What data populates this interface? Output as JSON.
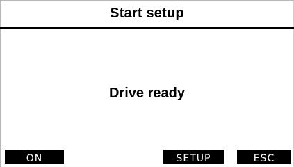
{
  "header": {
    "title": "Start setup"
  },
  "main": {
    "message": "Drive ready"
  },
  "softkeys": {
    "on": "ON",
    "setup": "SETUP",
    "esc": "ESC"
  },
  "colors": {
    "background": "#ffffff",
    "foreground": "#000000",
    "softkey_text": "#ffffff"
  }
}
